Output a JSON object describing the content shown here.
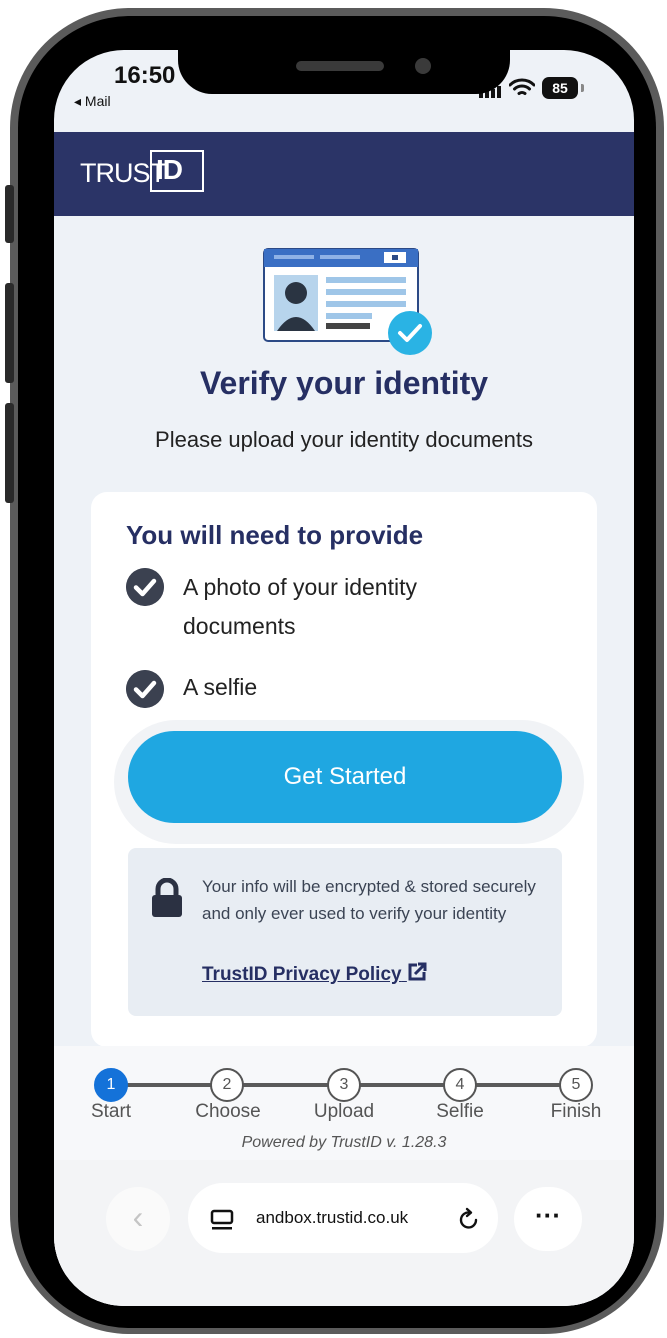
{
  "status_bar": {
    "time": "16:50",
    "back_app": "◂ Mail",
    "battery": "85"
  },
  "header": {
    "logo_trust": "TRUST",
    "logo_id": "ID"
  },
  "main": {
    "title": "Verify your identity",
    "subtitle": "Please upload your identity documents"
  },
  "requirements": {
    "heading": "You will need to provide",
    "items": [
      {
        "line1": "A photo of your identity",
        "line2": "documents"
      },
      {
        "line1": "A selfie"
      }
    ]
  },
  "cta": {
    "label": "Get Started"
  },
  "security": {
    "text": "Your info will be encrypted & stored securely and only ever used to verify your identity",
    "privacy_link": "TrustID Privacy Policy"
  },
  "steps": [
    {
      "num": "1",
      "label": "Start",
      "active": true
    },
    {
      "num": "2",
      "label": "Choose",
      "active": false
    },
    {
      "num": "3",
      "label": "Upload",
      "active": false
    },
    {
      "num": "4",
      "label": "Selfie",
      "active": false
    },
    {
      "num": "5",
      "label": "Finish",
      "active": false
    }
  ],
  "footer": {
    "powered_by": "Powered by TrustID v. 1.28.3"
  },
  "browser": {
    "url": "andbox.trustid.co.uk",
    "back_icon": "chevron-left-icon",
    "more_icon": "more-dots-icon",
    "reload_icon": "reload-icon",
    "tabs_icon": "page-tab-icon"
  },
  "colors": {
    "header": "#2b3467",
    "accent": "#1fa7e1",
    "step_active": "#1472d9",
    "heading": "#262f63"
  }
}
